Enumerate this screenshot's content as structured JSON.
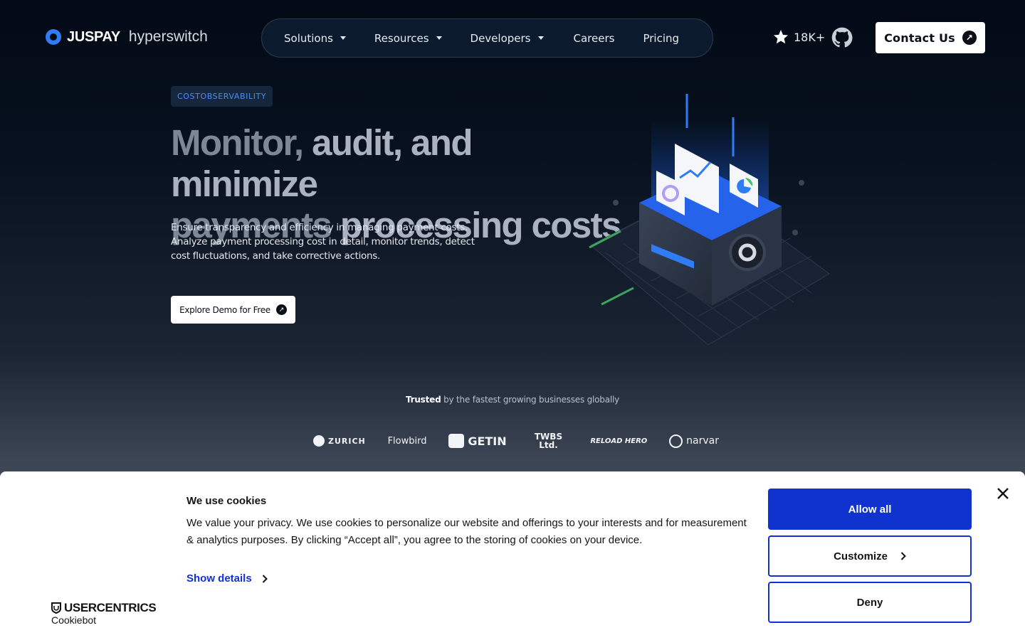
{
  "header": {
    "logo_primary": "JUSPAY",
    "logo_secondary": "hyperswitch",
    "nav": [
      {
        "label": "Solutions",
        "has_caret": true
      },
      {
        "label": "Resources",
        "has_caret": true
      },
      {
        "label": "Developers",
        "has_caret": true
      },
      {
        "label": "Careers",
        "has_caret": false
      },
      {
        "label": "Pricing",
        "has_caret": false
      }
    ],
    "github_stars": "18K+",
    "contact_label": "Contact Us"
  },
  "hero": {
    "tag": "COSTOBSERVABILITY",
    "title_line1_dim": "Monitor,",
    "title_line1_bright": "audit, and minimize",
    "title_line2_dim": "payments",
    "title_line2_bright": "processing costs",
    "description": "Ensure transparency and efficiency in managing payment costs. Analyze payment processing cost in detail, monitor trends, detect cost fluctuations, and take corrective actions.",
    "cta_label": "Explore Demo for Free"
  },
  "trusted": {
    "bold": "Trusted",
    "rest": "by the fastest growing businesses globally",
    "brands": [
      "ZURICH",
      "Flowbird",
      "GETIN",
      "TWBS Ltd.",
      "RELOAD HERO",
      "narvar"
    ]
  },
  "cookie": {
    "title": "We use cookies",
    "text": "We value your privacy. We use cookies to personalize our website and offerings to your interests and for measurement & analytics purposes. By clicking “Accept all”, you agree to the storing of cookies on your device.",
    "show_details": "Show details",
    "allow_all": "Allow all",
    "customize": "Customize",
    "deny": "Deny",
    "brand_top": "USERCENTRICS",
    "brand_bottom": "Cookiebot"
  },
  "colors": {
    "accent_blue": "#1032cf",
    "tag_blue": "#4d8df0",
    "hero_bg": "#030a16"
  }
}
